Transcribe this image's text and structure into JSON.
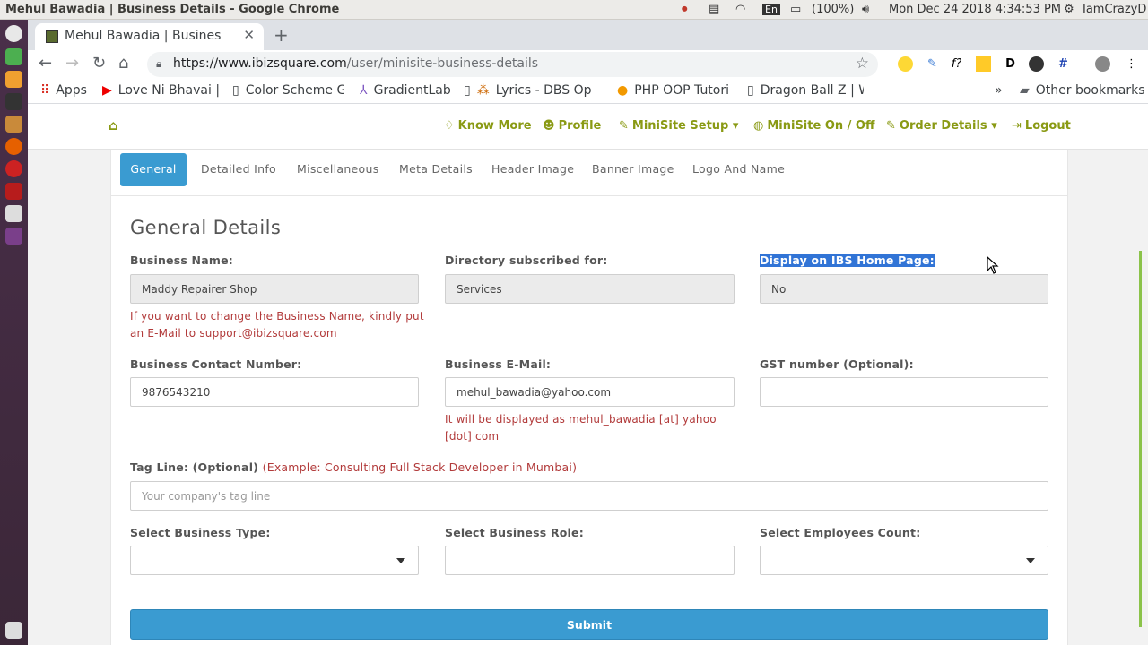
{
  "os": {
    "window_title": "Mehul Bawadia | Business Details - Google Chrome",
    "keyboard": "En",
    "battery": "(100%)",
    "datetime": "Mon Dec 24 2018  4:34:53 PM",
    "user": "IamCrazyD"
  },
  "browser": {
    "tab_title": "Mehul Bawadia | Business",
    "url_domain": "https://www.ibizsquare.com",
    "url_path": "/user/minisite-business-details",
    "bookmarks": [
      "Apps",
      "Love Ni Bhavai |",
      "Color Scheme G",
      "GradientLab",
      "Lyrics - DBS Op",
      "PHP OOP Tutori",
      "Dragon Ball Z | W"
    ],
    "bookmarks_more": "»",
    "other_bookmarks": "Other bookmarks"
  },
  "nav": {
    "know_more": "Know More",
    "profile": "Profile",
    "minisite_setup": "MiniSite Setup",
    "minisite_onoff": "MiniSite On / Off",
    "order_details": "Order Details",
    "logout": "Logout"
  },
  "tabs": [
    "General",
    "Detailed Info",
    "Miscellaneous",
    "Meta Details",
    "Header Image",
    "Banner Image",
    "Logo And Name"
  ],
  "form": {
    "title": "General Details",
    "business_name_label": "Business Name:",
    "business_name_value": "Maddy Repairer Shop",
    "business_name_help": "If you want to change the Business Name, kindly put an E-Mail to support@ibizsquare.com",
    "directory_label": "Directory subscribed for:",
    "directory_value": "Services",
    "display_label": "Display on IBS Home Page:",
    "display_value": "No",
    "contact_label": "Business Contact Number:",
    "contact_value": "9876543210",
    "email_label": "Business E-Mail:",
    "email_value": "mehul_bawadia@yahoo.com",
    "email_help": "It will be displayed as mehul_bawadia [at] yahoo [dot] com",
    "gst_label": "GST number (Optional):",
    "gst_value": "",
    "tagline_label": "Tag Line: (Optional)",
    "tagline_example": "(Example: Consulting Full Stack Developer in Mumbai)",
    "tagline_placeholder": "Your company's tag line",
    "type_label": "Select Business Type:",
    "role_label": "Select Business Role:",
    "employees_label": "Select Employees Count:",
    "submit": "Submit"
  }
}
